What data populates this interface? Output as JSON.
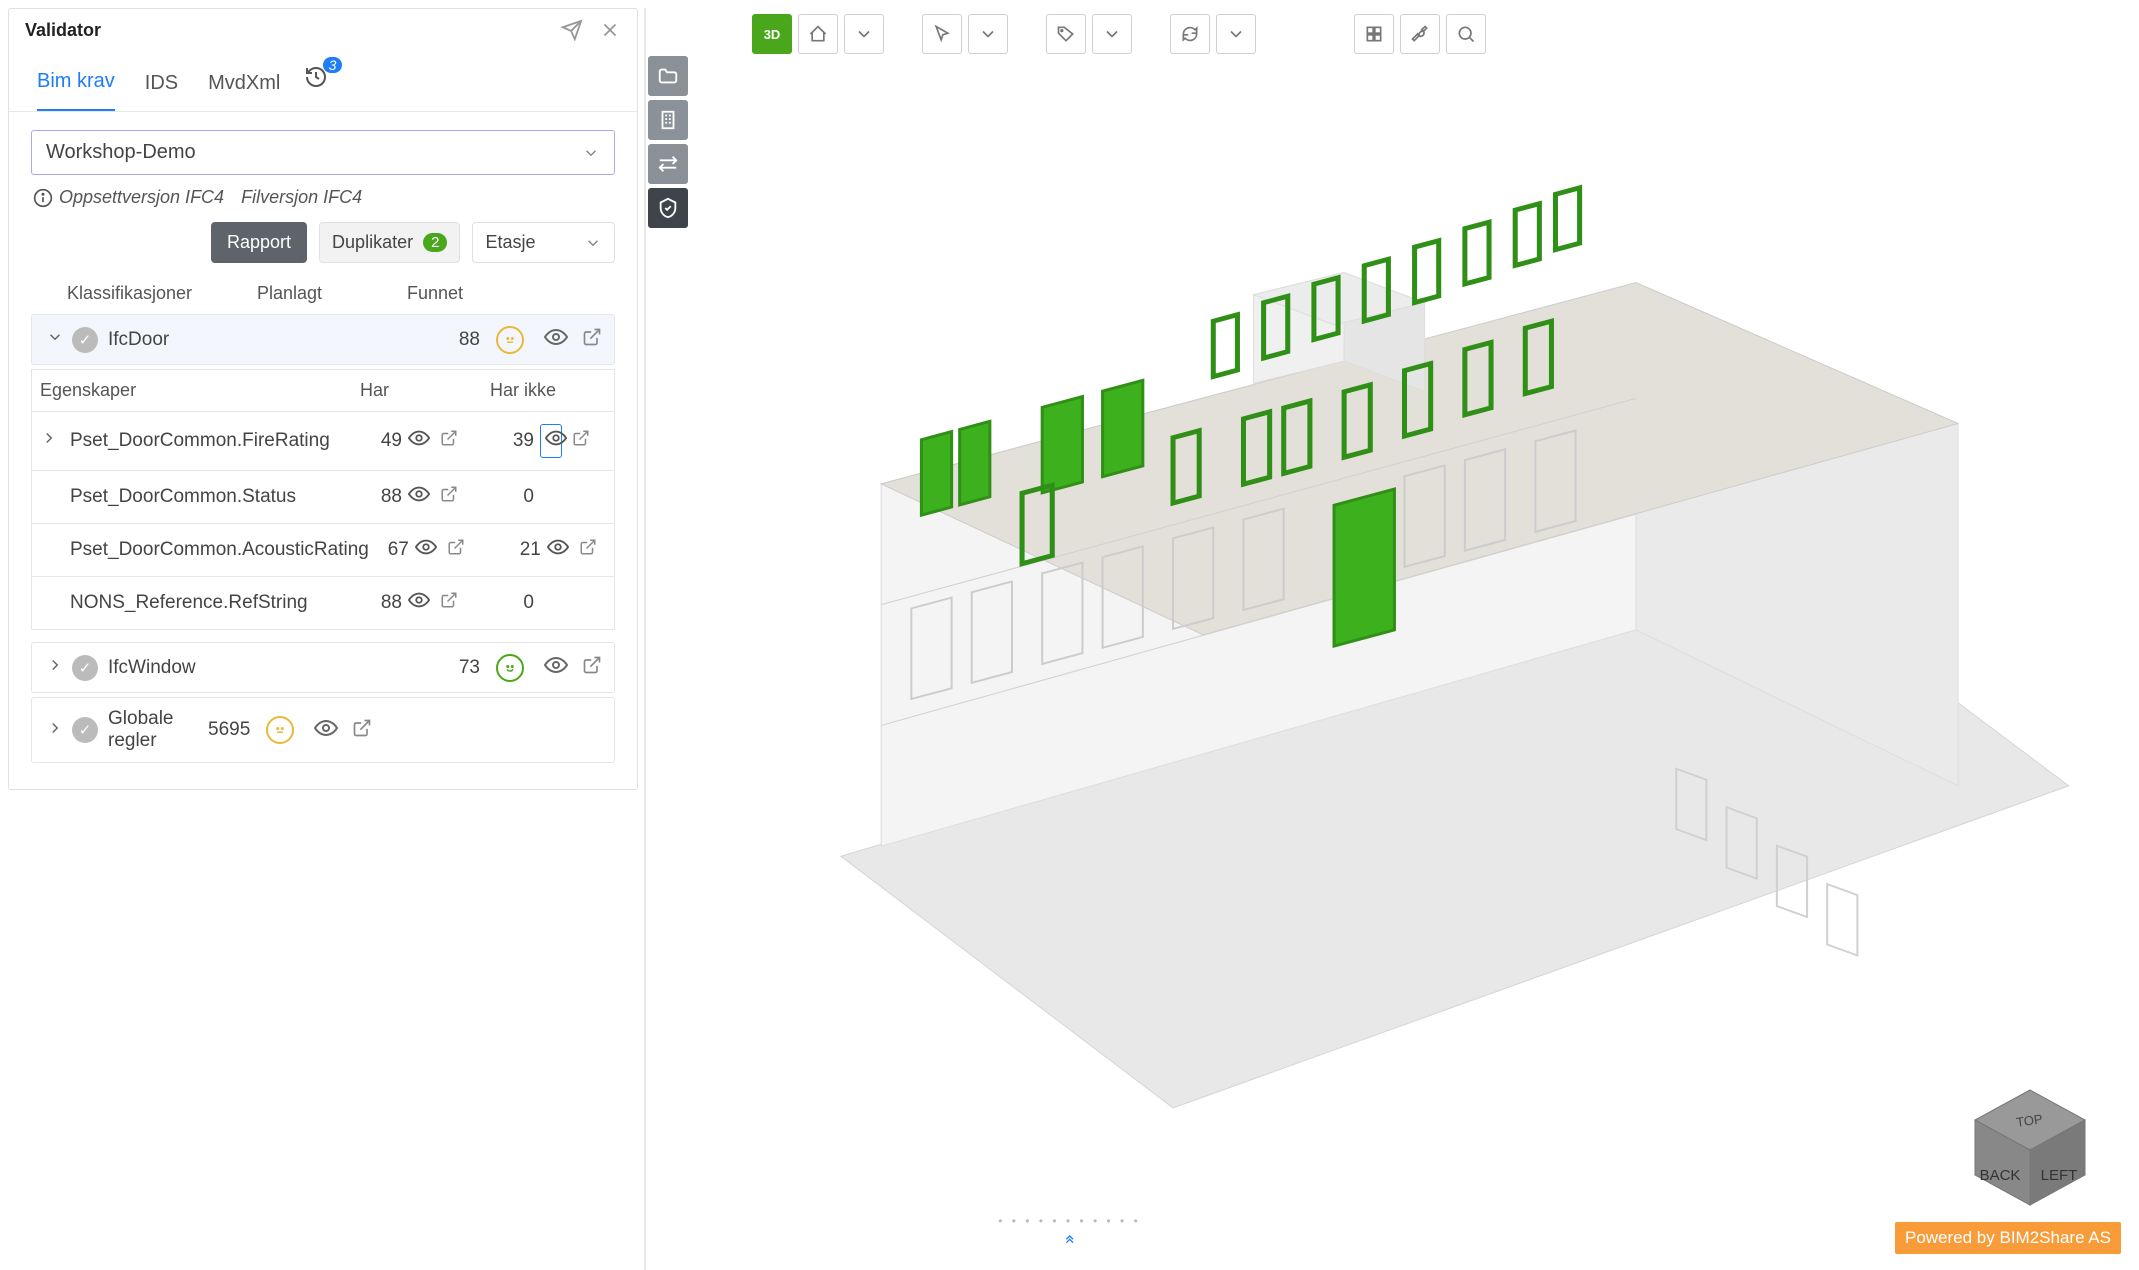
{
  "panel": {
    "title": "Validator"
  },
  "tabs": {
    "items": [
      "Bim krav",
      "IDS",
      "MvdXml"
    ],
    "history_count": "3"
  },
  "select": {
    "value": "Workshop-Demo"
  },
  "meta": {
    "setup": "Oppsettversjon IFC4",
    "file": "Filversjon IFC4"
  },
  "buttons": {
    "rapport": "Rapport",
    "dup": "Duplikater",
    "dup_count": "2",
    "floor": "Etasje"
  },
  "thead": [
    "Klassifikasjoner",
    "Planlagt",
    "Funnet"
  ],
  "rows": [
    {
      "name": "IfcDoor",
      "found": "88",
      "expanded": true,
      "face": "neutral"
    },
    {
      "name": "IfcWindow",
      "found": "73",
      "face": "happy"
    },
    {
      "name": "Globale regler",
      "found": "5695",
      "face": "neutral"
    }
  ],
  "phead": [
    "Egenskaper",
    "Har",
    "Har ikke"
  ],
  "props": [
    {
      "name": "Pset_DoorCommon.FireRating",
      "has": "49",
      "not": "39",
      "exp": true,
      "hi": true
    },
    {
      "name": "Pset_DoorCommon.Status",
      "has": "88",
      "not": "0"
    },
    {
      "name": "Pset_DoorCommon.AcousticRating",
      "has": "67",
      "not": "21"
    },
    {
      "name": "NONS_Reference.RefString",
      "has": "88",
      "not": "0"
    }
  ],
  "viewer": {
    "mode": "3D"
  },
  "cube": {
    "top": "TOP",
    "back": "BACK",
    "left": "LEFT"
  },
  "footer": "Powered by BIM2Share AS"
}
